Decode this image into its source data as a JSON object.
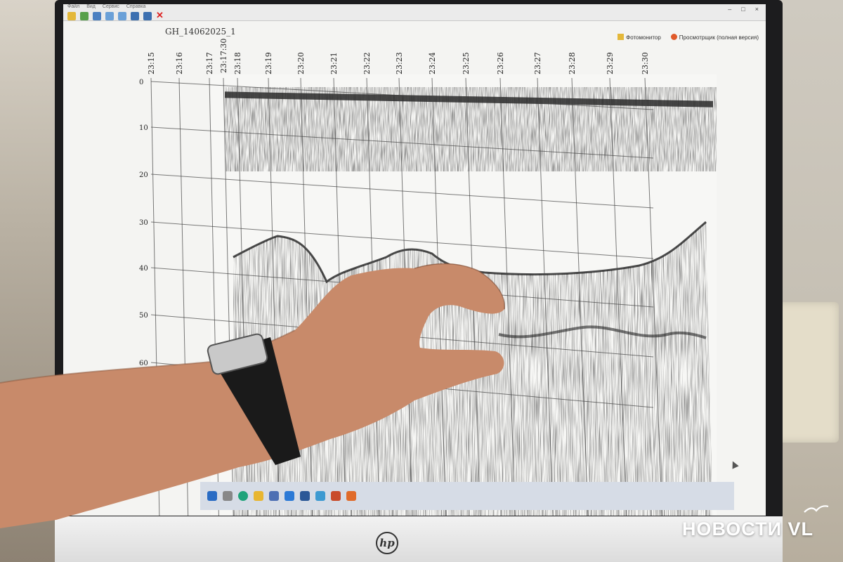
{
  "window": {
    "menu": [
      "Файл",
      "Вид",
      "Сервис",
      "Справка"
    ],
    "controls": [
      "–",
      "□",
      "×"
    ]
  },
  "toolbar": {
    "buttons": [
      "open-icon",
      "save-icon",
      "print-icon",
      "zoom-in-icon",
      "zoom-out-icon",
      "close-icon"
    ],
    "close_label": "✕"
  },
  "file": {
    "name": "GH_14062025_1"
  },
  "toplinks": {
    "photomonitor": "Фотомонитор",
    "viewer": "Просмотрщик (полная версия)"
  },
  "time_axis": {
    "labels": [
      "23:15",
      "23:16",
      "23:17",
      "23:17:30",
      "23:18",
      "23:19",
      "23:20",
      "23:21",
      "23:22",
      "23:23",
      "23:24",
      "23:25",
      "23:26",
      "23:27",
      "23:28",
      "23:29",
      "23:30"
    ]
  },
  "depth_axis": {
    "labels": [
      "0",
      "10",
      "20",
      "30",
      "40",
      "50",
      "60"
    ]
  },
  "taskbar": {
    "icons": [
      "windows-icon",
      "search-icon",
      "edge-icon",
      "explorer-icon",
      "store-icon",
      "mail-icon",
      "word-icon",
      "app-icon",
      "app-icon",
      "app-icon"
    ]
  },
  "watermark": {
    "text": "НОВОСТИ VL"
  },
  "hp": {
    "logo": "hp"
  },
  "colors": {
    "window_bg": "#f4f4f2",
    "grid": "#333333",
    "echo": "#1e1e1e",
    "close": "#dd2222"
  }
}
